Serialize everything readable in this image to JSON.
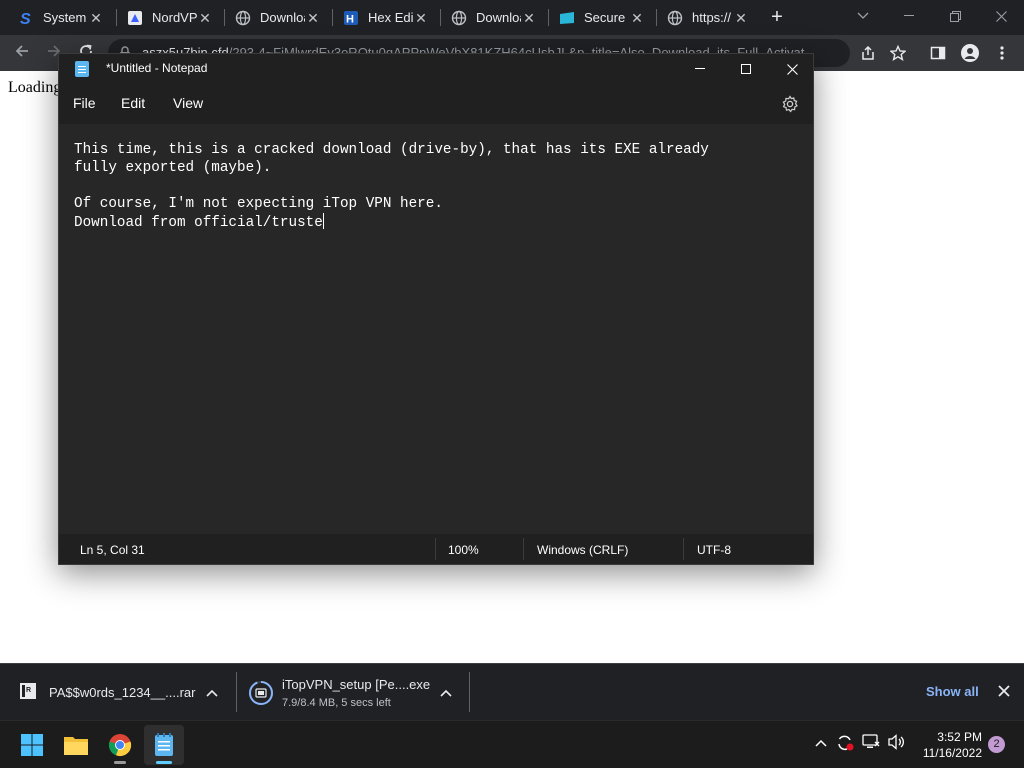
{
  "browser": {
    "tabs": [
      {
        "title": "System",
        "favicon": "s-logo-icon",
        "active": false
      },
      {
        "title": "NordVPN",
        "favicon": "nordvpn-icon",
        "active": false
      },
      {
        "title": "Download",
        "favicon": "globe-icon",
        "active": false
      },
      {
        "title": "Hex Editor",
        "favicon": "hex-editor-icon",
        "active": false
      },
      {
        "title": "Download",
        "favicon": "globe-icon",
        "active": false
      },
      {
        "title": "Secure",
        "favicon": "secure-folder-icon",
        "active": false
      },
      {
        "title": "https://",
        "favicon": "globe-icon",
        "active": true
      }
    ],
    "url_host": "aszx5u7bin.cfd",
    "url_path": "/293-4~FiMlwrdEv3oRQtu0qAPPnWeVbX81KZH64cUsbJL&p_title=Also_Download_its_Full_Activat..."
  },
  "page": {
    "loading_text": "Loading"
  },
  "notepad": {
    "title": "*Untitled - Notepad",
    "menu": {
      "file": "File",
      "edit": "Edit",
      "view": "View"
    },
    "lines": [
      "This time, this is a cracked download (drive-by), that has its EXE already",
      "fully exported (maybe).",
      "",
      "Of course, I'm not expecting iTop VPN here.",
      "Download from official/truste"
    ],
    "status": {
      "position": "Ln 5, Col 31",
      "zoom": "100%",
      "line_ending": "Windows (CRLF)",
      "encoding": "UTF-8"
    }
  },
  "downloads": {
    "items": [
      {
        "name": "PA$$w0rds_1234__....rar",
        "status": "",
        "icon": "rar-archive-icon"
      },
      {
        "name": "iTopVPN_setup [Pe....exe",
        "status": "7.9/8.4 MB, 5 secs left",
        "icon": "exe-file-icon",
        "progress": 0.94
      }
    ],
    "show_all": "Show all"
  },
  "taskbar": {
    "apps": [
      "start-icon",
      "file-explorer-icon",
      "chrome-icon",
      "notepad-icon"
    ],
    "time": "3:52 PM",
    "date": "11/16/2022",
    "notifications": "2"
  },
  "colors": {
    "chrome_dark": "#202124",
    "notepad_bg": "#272727",
    "link_blue": "#8ab4f8",
    "taskbar": "#1c1c1c"
  }
}
